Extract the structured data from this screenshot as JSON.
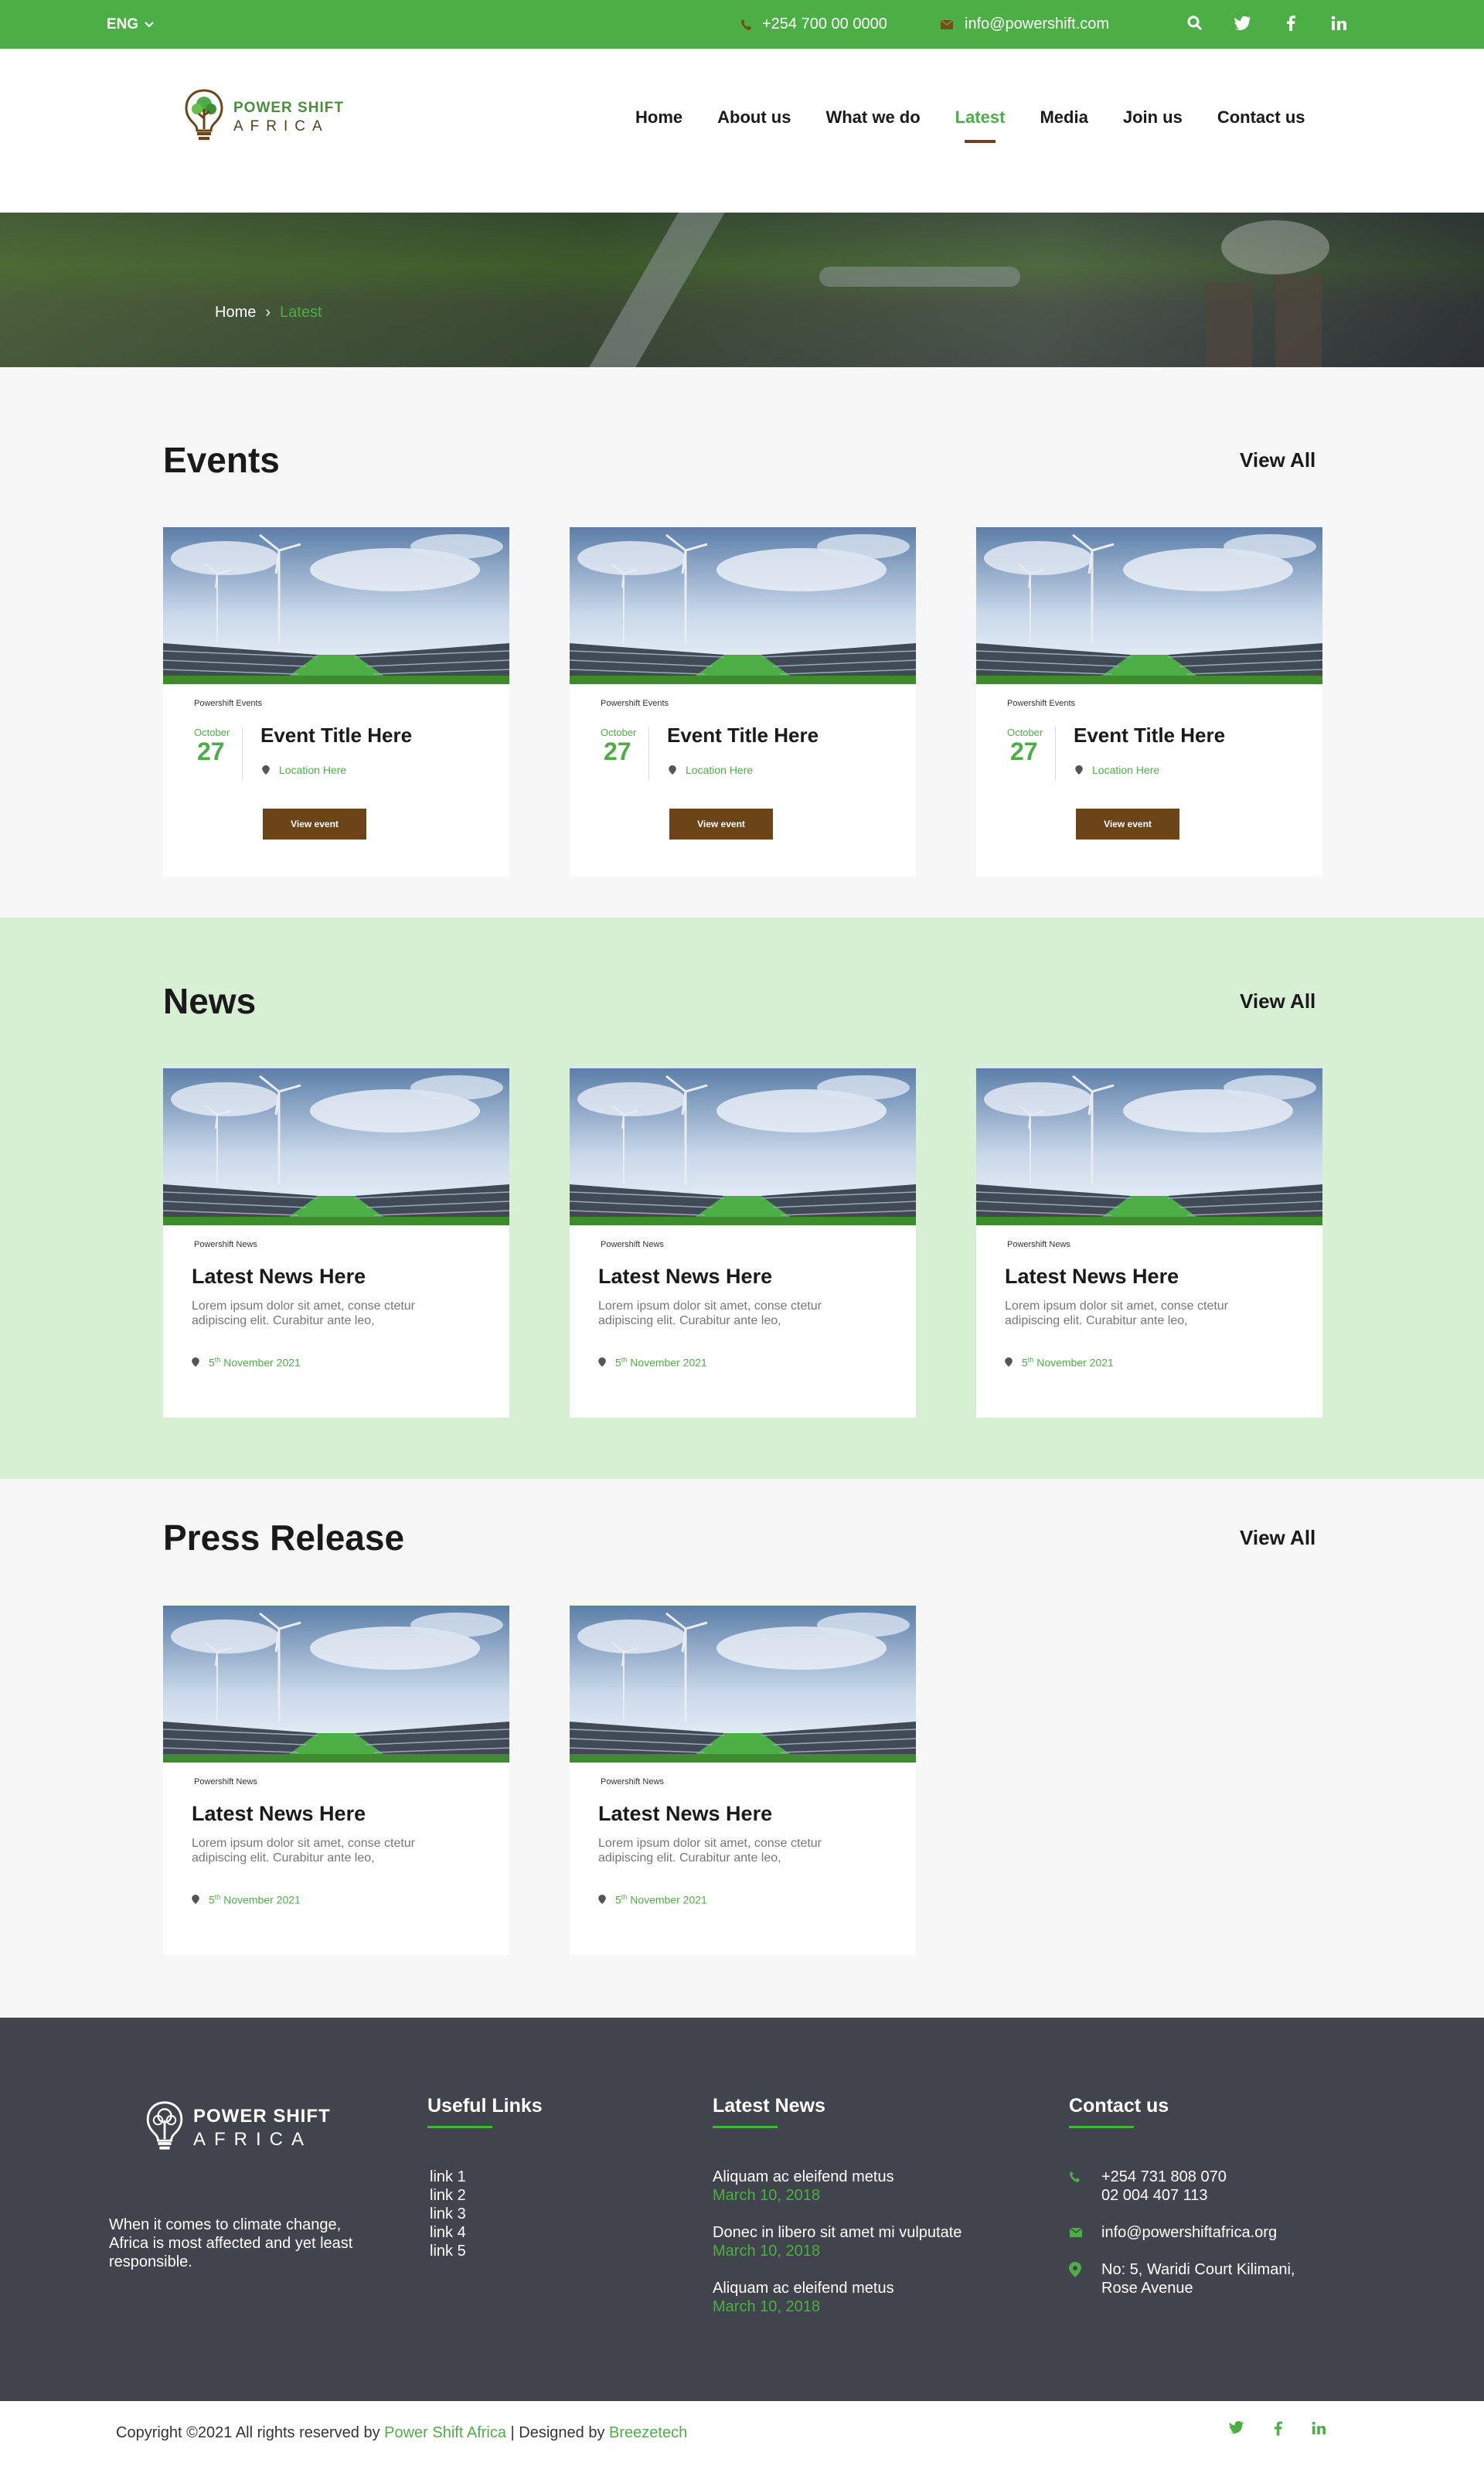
{
  "topbar": {
    "language": "ENG",
    "phone": "+254 700 00 0000",
    "email": "info@powershift.com",
    "icons": [
      "search-icon",
      "twitter-icon",
      "facebook-icon",
      "linkedin-icon"
    ]
  },
  "header": {
    "logo_line1": "POWER SHIFT",
    "logo_line2": "AFRICA",
    "nav": [
      "Home",
      "About us",
      "What we do",
      "Latest",
      "Media",
      "Join us",
      "Contact us"
    ],
    "active": "Latest"
  },
  "hero": {
    "breadcrumb_home": "Home",
    "breadcrumb_sep": "›",
    "breadcrumb_current": "Latest"
  },
  "events": {
    "title": "Events",
    "view_all": "View All",
    "items": [
      {
        "tag": "Powershift Events",
        "month": "October",
        "day": "27",
        "title": "Event Title Here",
        "location": "Location Here",
        "button": "View event"
      },
      {
        "tag": "Powershift Events",
        "month": "October",
        "day": "27",
        "title": "Event Title Here",
        "location": "Location Here",
        "button": "View event"
      },
      {
        "tag": "Powershift Events",
        "month": "October",
        "day": "27",
        "title": "Event Title Here",
        "location": "Location Here",
        "button": "View event"
      }
    ]
  },
  "news": {
    "title": "News",
    "view_all": "View All",
    "items": [
      {
        "tag": "Powershift News",
        "title": "Latest News Here",
        "excerpt": "Lorem ipsum dolor sit amet, conse ctetur adipiscing elit. Curabitur ante leo,",
        "date_day": "5",
        "date_suffix": "th",
        "date_rest": "November 2021"
      },
      {
        "tag": "Powershift News",
        "title": "Latest News Here",
        "excerpt": "Lorem ipsum dolor sit amet, conse ctetur adipiscing elit. Curabitur ante leo,",
        "date_day": "5",
        "date_suffix": "th",
        "date_rest": "November 2021"
      },
      {
        "tag": "Powershift News",
        "title": "Latest News Here",
        "excerpt": "Lorem ipsum dolor sit amet, conse ctetur adipiscing elit. Curabitur ante leo,",
        "date_day": "5",
        "date_suffix": "th",
        "date_rest": "November 2021"
      }
    ]
  },
  "press": {
    "title": "Press Release",
    "view_all": "View All",
    "items": [
      {
        "tag": "Powershift News",
        "title": "Latest News Here",
        "excerpt": "Lorem ipsum dolor sit amet, conse ctetur adipiscing elit. Curabitur ante leo,",
        "date_day": "5",
        "date_suffix": "th",
        "date_rest": "November 2021"
      },
      {
        "tag": "Powershift News",
        "title": "Latest News Here",
        "excerpt": "Lorem ipsum dolor sit amet, conse ctetur adipiscing elit. Curabitur ante leo,",
        "date_day": "5",
        "date_suffix": "th",
        "date_rest": "November 2021"
      }
    ]
  },
  "footer": {
    "logo_line1": "POWER SHIFT",
    "logo_line2": "AFRICA",
    "tagline": "When it comes to climate change, Africa is most affected and yet least responsible.",
    "useful_links_title": "Useful Links",
    "links": [
      "link 1",
      "link 2",
      "link 3",
      "link 4",
      "link 5"
    ],
    "latest_news_title": "Latest News",
    "latest_news": [
      {
        "title": "Aliquam ac eleifend metus",
        "date": "March 10, 2018"
      },
      {
        "title": "Donec in libero sit amet mi vulputate",
        "date": "March 10, 2018"
      },
      {
        "title": "Aliquam ac eleifend metus",
        "date": "March 10, 2018"
      }
    ],
    "contact_title": "Contact us",
    "phone1": "+254 731 808 070",
    "phone2": "02 004 407 113",
    "email": "info@powershiftafrica.org",
    "address1": "No: 5, Waridi Court Kilimani,",
    "address2": "Rose Avenue"
  },
  "bottombar": {
    "copy_prefix": "Copyright ©2021 All rights reserved by ",
    "company": "Power Shift Africa",
    "designed_by": " | Designed by ",
    "designer": "Breezetech"
  },
  "colors": {
    "green": "#4caf45",
    "brown": "#6b4518",
    "footer": "#41444c",
    "news_bg": "#d7f0d4"
  }
}
